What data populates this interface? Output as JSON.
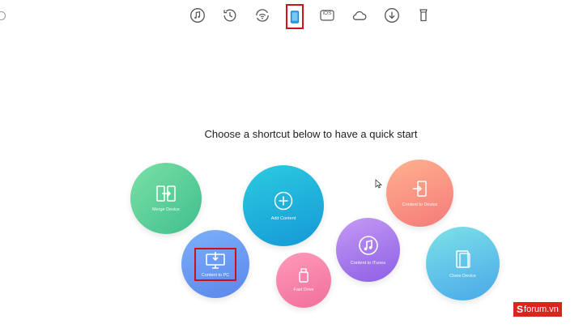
{
  "toolbar": {
    "items": [
      {
        "name": "music-icon",
        "active": false
      },
      {
        "name": "backup-history-icon",
        "active": false
      },
      {
        "name": "wifi-sync-icon",
        "active": false
      },
      {
        "name": "phone-device-icon",
        "active": true
      },
      {
        "name": "ios-icon",
        "active": false
      },
      {
        "name": "icloud-icon",
        "active": false
      },
      {
        "name": "download-icon",
        "active": false
      },
      {
        "name": "toolkit-icon",
        "active": false
      }
    ],
    "ios_text": "iOS"
  },
  "headline": "Choose a shortcut below to have a quick start",
  "shortcuts": {
    "merge_device": "Merge Device",
    "add_content": "Add Content",
    "content_to_pc": "Content to PC",
    "fast_drive": "Fast Drive",
    "content_to_itunes": "Content to iTunes",
    "content_to_device": "Content to Device",
    "clone_device": "Clone Device"
  },
  "watermark": {
    "mark": "S",
    "text": "forum.vn"
  },
  "colors": {
    "highlight": "#c8111a",
    "accent": "#1598d6"
  }
}
